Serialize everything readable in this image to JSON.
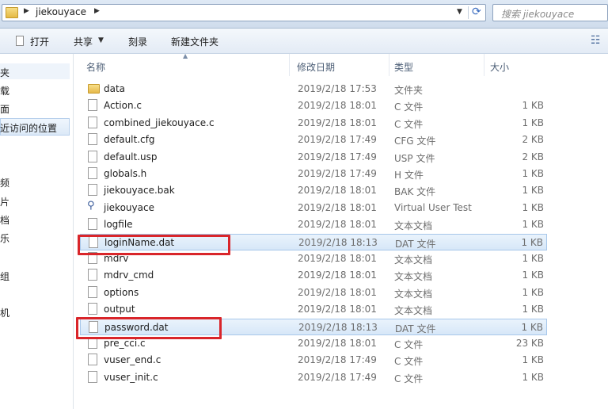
{
  "address": {
    "path": "jiekouyace",
    "search_placeholder": "搜索 jiekouyace"
  },
  "toolbar": {
    "open": "打开",
    "share": "共享",
    "burn": "刻录",
    "new_folder": "新建文件夹"
  },
  "nav": {
    "items": [
      "夹",
      "载",
      "面",
      "近访问的位置",
      "频",
      "片",
      "档",
      "乐",
      "组",
      "机"
    ]
  },
  "columns": {
    "name": "名称",
    "date": "修改日期",
    "type": "类型",
    "size": "大小"
  },
  "files": [
    {
      "name": "data",
      "date": "2019/2/18 17:53",
      "type": "文件夹",
      "size": "",
      "icon": "folder-icon"
    },
    {
      "name": "Action.c",
      "date": "2019/2/18 18:01",
      "type": "C 文件",
      "size": "1 KB",
      "icon": "file-icon"
    },
    {
      "name": "combined_jiekouyace.c",
      "date": "2019/2/18 18:01",
      "type": "C 文件",
      "size": "1 KB",
      "icon": "file-icon"
    },
    {
      "name": "default.cfg",
      "date": "2019/2/18 17:49",
      "type": "CFG 文件",
      "size": "2 KB",
      "icon": "file-icon"
    },
    {
      "name": "default.usp",
      "date": "2019/2/18 17:49",
      "type": "USP 文件",
      "size": "2 KB",
      "icon": "file-icon"
    },
    {
      "name": "globals.h",
      "date": "2019/2/18 17:49",
      "type": "H 文件",
      "size": "1 KB",
      "icon": "file-icon"
    },
    {
      "name": "jiekouyace.bak",
      "date": "2019/2/18 18:01",
      "type": "BAK 文件",
      "size": "1 KB",
      "icon": "file-icon"
    },
    {
      "name": "jiekouyace",
      "date": "2019/2/18 18:01",
      "type": "Virtual User Test",
      "size": "1 KB",
      "icon": "vugen-script-icon"
    },
    {
      "name": "logfile",
      "date": "2019/2/18 18:01",
      "type": "文本文档",
      "size": "1 KB",
      "icon": "file-icon"
    },
    {
      "name": "loginName.dat",
      "date": "2019/2/18 18:13",
      "type": "DAT 文件",
      "size": "1 KB",
      "icon": "file-icon"
    },
    {
      "name": "mdrv",
      "date": "2019/2/18 18:01",
      "type": "文本文档",
      "size": "1 KB",
      "icon": "file-icon"
    },
    {
      "name": "mdrv_cmd",
      "date": "2019/2/18 18:01",
      "type": "文本文档",
      "size": "1 KB",
      "icon": "file-icon"
    },
    {
      "name": "options",
      "date": "2019/2/18 18:01",
      "type": "文本文档",
      "size": "1 KB",
      "icon": "file-icon"
    },
    {
      "name": "output",
      "date": "2019/2/18 18:01",
      "type": "文本文档",
      "size": "1 KB",
      "icon": "file-icon"
    },
    {
      "name": "password.dat",
      "date": "2019/2/18 18:13",
      "type": "DAT 文件",
      "size": "1 KB",
      "icon": "file-icon"
    },
    {
      "name": "pre_cci.c",
      "date": "2019/2/18 18:01",
      "type": "C 文件",
      "size": "23 KB",
      "icon": "file-icon"
    },
    {
      "name": "vuser_end.c",
      "date": "2019/2/18 17:49",
      "type": "C 文件",
      "size": "1 KB",
      "icon": "file-icon"
    },
    {
      "name": "vuser_init.c",
      "date": "2019/2/18 17:49",
      "type": "C 文件",
      "size": "1 KB",
      "icon": "file-icon"
    }
  ],
  "colors": {
    "highlight": "#d9252a",
    "selection": "#d7e7f8"
  }
}
